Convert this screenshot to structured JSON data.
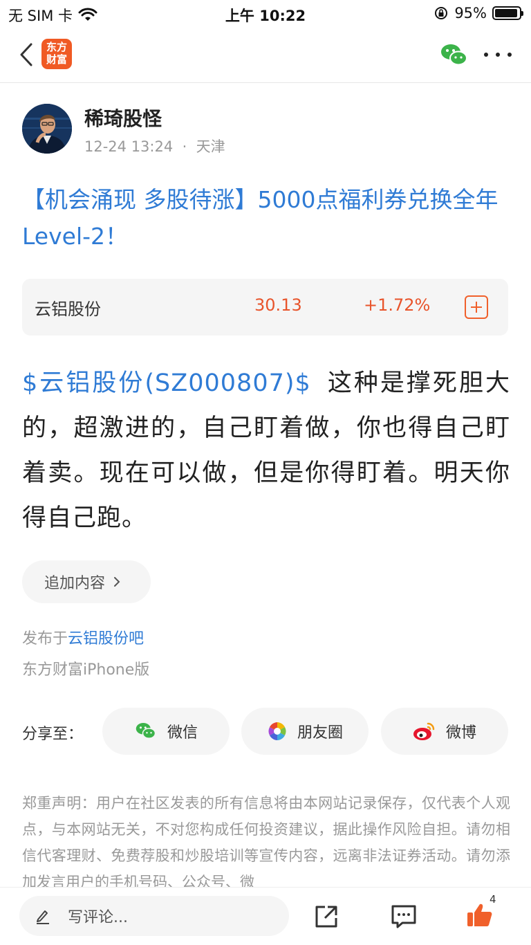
{
  "status_bar": {
    "carrier": "无 SIM 卡",
    "time": "上午 10:22",
    "battery_pct": "95%",
    "battery_level": 0.95
  },
  "nav": {
    "logo_text": "东方财富"
  },
  "author": {
    "name": "稀琦股怪",
    "date": "12-24 13:24",
    "location": "天津"
  },
  "post": {
    "title": "【机会涌现 多股待涨】5000点福利券兑换全年Level-2！",
    "stock_link": "$云铝股份(SZ000807)$",
    "body": "这种是撑死胆大的，超激进的，自己盯着做，你也得自己盯着卖。现在可以做，但是你得盯着。明天你得自己跑。"
  },
  "stock_card": {
    "name": "云铝股份",
    "price": "30.13",
    "change": "+1.72%"
  },
  "append_label": "追加内容",
  "publish": {
    "prefix": "发布于",
    "forum": "云铝股份吧",
    "client": "东方财富iPhone版"
  },
  "share": {
    "label": "分享至：",
    "wechat": "微信",
    "moments": "朋友圈",
    "weibo": "微博"
  },
  "disclaimer": "郑重声明：用户在社区发表的所有信息将由本网站记录保存，仅代表个人观点，与本网站无关，不对您构成任何投资建议，据此操作风险自担。请勿相信代客理财、免费荐股和炒股培训等宣传内容，远离非法证券活动。请勿添加发言用户的手机号码、公众号、微",
  "bottom_bar": {
    "comment_placeholder": "写评论...",
    "like_count": "4"
  },
  "colors": {
    "accent_blue": "#2f7bd5",
    "rise_red": "#e8542b",
    "brand_orange": "#f05a24"
  }
}
